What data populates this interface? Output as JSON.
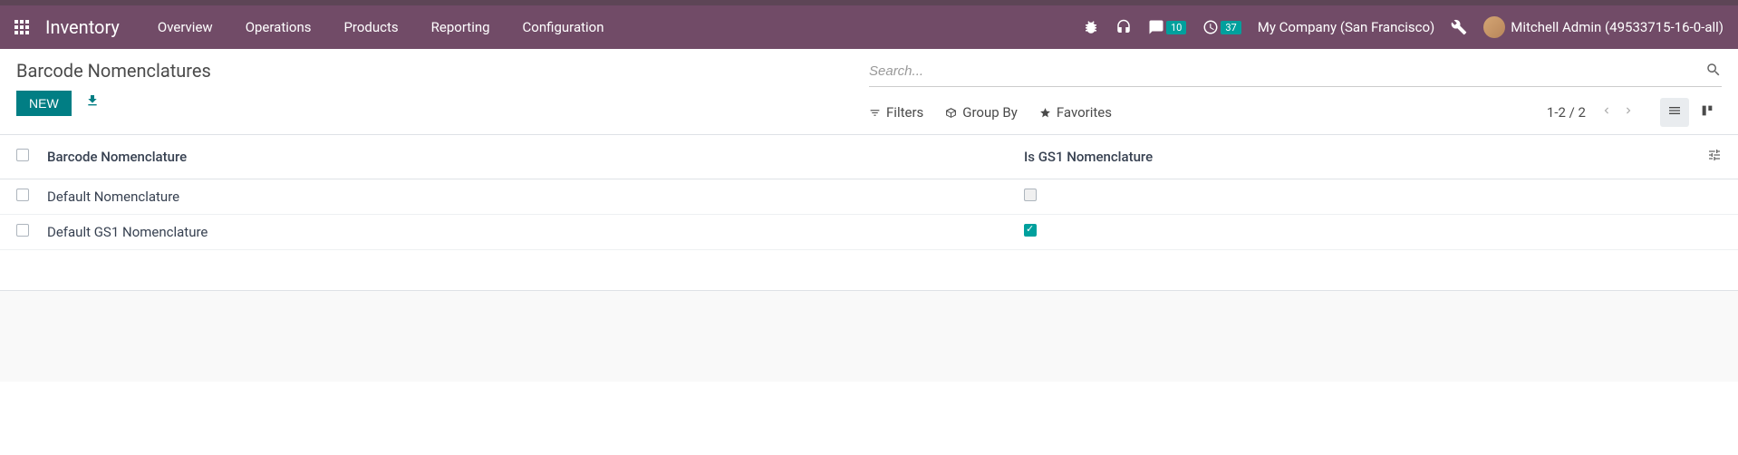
{
  "navbar": {
    "app_name": "Inventory",
    "menu": [
      "Overview",
      "Operations",
      "Products",
      "Reporting",
      "Configuration"
    ],
    "messages_badge": "10",
    "activities_badge": "37",
    "company": "My Company (San Francisco)",
    "user": "Mitchell Admin (49533715-16-0-all)"
  },
  "control_panel": {
    "breadcrumb": "Barcode Nomenclatures",
    "new_button": "NEW",
    "search_placeholder": "Search...",
    "filters_label": "Filters",
    "groupby_label": "Group By",
    "favorites_label": "Favorites",
    "pager": "1-2 / 2"
  },
  "table": {
    "headers": {
      "name": "Barcode Nomenclature",
      "gs1": "Is GS1 Nomenclature"
    },
    "rows": [
      {
        "name": "Default Nomenclature",
        "is_gs1": false
      },
      {
        "name": "Default GS1 Nomenclature",
        "is_gs1": true
      }
    ]
  }
}
